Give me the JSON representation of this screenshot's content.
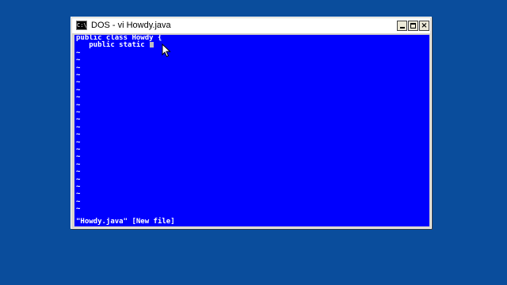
{
  "window": {
    "title": "DOS - vi Howdy.java",
    "icon_label": "C:\\",
    "controls": {
      "minimize": "minimize-icon",
      "maximize": "maximize-icon",
      "close": "×"
    }
  },
  "editor": {
    "lines": [
      "public class Howdy {",
      "   public static "
    ],
    "empty_marker": "~",
    "status": "\"Howdy.java\" [New file]"
  },
  "colors": {
    "desktop": "#0a4d9c",
    "console_bg": "#0000fe",
    "console_fg": "#ffffff"
  }
}
